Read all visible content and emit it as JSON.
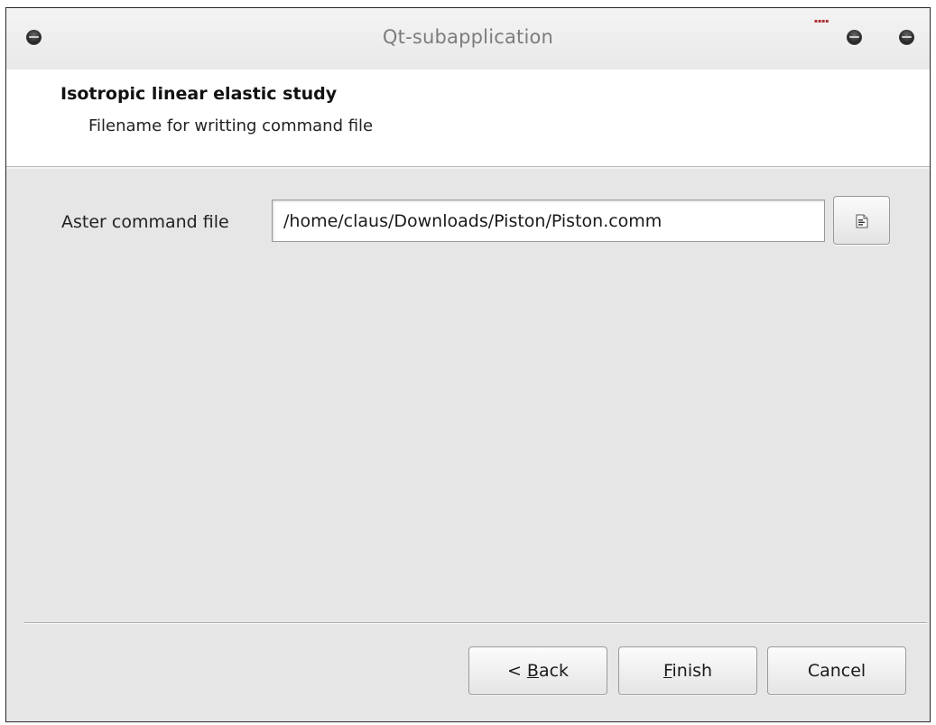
{
  "window": {
    "title": "Qt-subapplication"
  },
  "wizard": {
    "title": "Isotropic linear elastic study",
    "subtitle": "Filename for writting command file"
  },
  "form": {
    "field_label": "Aster command file",
    "path_value": "/home/claus/Downloads/Piston/Piston.comm",
    "browse_icon": "document-icon"
  },
  "buttons": {
    "back_prefix": "< ",
    "back_mnemonic": "B",
    "back_rest": "ack",
    "finish_mnemonic": "F",
    "finish_rest": "inish",
    "cancel_label": "Cancel"
  },
  "colors": {
    "window_bg": "#e6e6e6",
    "header_bg": "#ffffff",
    "title_text": "#7c7c7c"
  }
}
